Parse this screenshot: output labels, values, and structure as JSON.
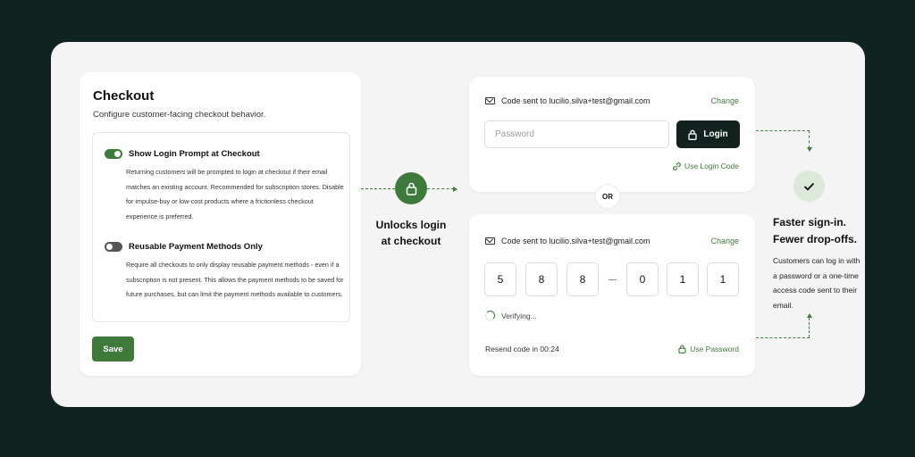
{
  "checkout": {
    "title": "Checkout",
    "subtitle": "Configure customer-facing checkout behavior.",
    "options": [
      {
        "title": "Show Login Prompt at Checkout",
        "enabled": true,
        "description": "Returning customers will be prompted to login at checkout if their email matches an existing account. Recommended for subscription stores. Disable for impulse-buy or low-cost products where a frictionless checkout experience is preferred."
      },
      {
        "title": "Reusable Payment Methods Only",
        "enabled": false,
        "description": "Require all checkouts to only display reusable payment methods - even if a subscription is not present. This allows the payment methods to be saved for future purchases, but can limit the payment methods available to customers."
      }
    ],
    "save_label": "Save"
  },
  "connector": {
    "label_line1": "Unlocks login",
    "label_line2": "at checkout",
    "icon": "lock-icon"
  },
  "password_login": {
    "code_sent": "Code sent to lucilio.silva+test@gmail.com",
    "change_label": "Change",
    "password_placeholder": "Password",
    "login_label": "Login",
    "use_code_label": "Use Login Code"
  },
  "or_label": "OR",
  "code_login": {
    "code_sent": "Code sent to lucilio.silva+test@gmail.com",
    "change_label": "Change",
    "digits": [
      "5",
      "8",
      "8",
      "0",
      "1",
      "1"
    ],
    "status": "Verifying...",
    "resend": "Resend code in 00:24",
    "use_password_label": "Use Password"
  },
  "benefit": {
    "headline_line1": "Faster sign-in.",
    "headline_line2": "Fewer drop-offs.",
    "description": "Customers can log in with a password or a one-time access code sent to their email."
  },
  "colors": {
    "accent": "#3e7b3b",
    "background": "#0f2320",
    "dark_button": "#14221f"
  }
}
